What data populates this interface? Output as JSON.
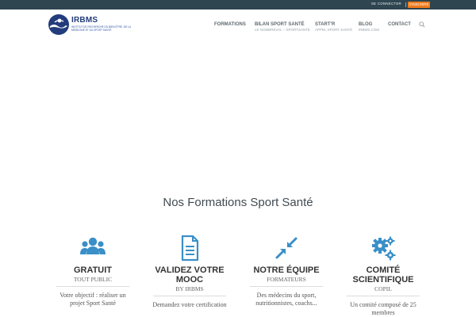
{
  "topbar": {
    "login_label": "SE CONNECTER",
    "signup_label": "S'INSCRIRE",
    "signup_color": "#f07a1a"
  },
  "logo": {
    "brand": "IRBMS",
    "tagline": "Institut de Recherche du Bien-être, de la Médecine et du Sport Santé"
  },
  "nav": {
    "items": [
      {
        "label": "FORMATIONS",
        "sub": ""
      },
      {
        "label": "BILAN SPORT SANTÉ",
        "sub": "LE NOMBREVAL – SPORTSANTÉ"
      },
      {
        "label": "START'R",
        "sub": "APPEL SPORT SANTÉ"
      },
      {
        "label": "BLOG",
        "sub": "IRBMS.COM"
      },
      {
        "label": "CONTACT",
        "sub": ""
      }
    ],
    "search_icon": "search-icon"
  },
  "main": {
    "section_title": "Nos Formations Sport Santé",
    "accent_color": "#3a8fc7",
    "cards": [
      {
        "icon": "users-icon",
        "title": "GRATUIT",
        "subtitle": "TOUT PUBLIC",
        "desc": "Votre objectif : réaliser un projet Sport Santé"
      },
      {
        "icon": "document-icon",
        "title": "VALIDEZ VOTRE MOOC",
        "subtitle": "BY IRBMS",
        "desc": "Demandez votre certification"
      },
      {
        "icon": "compress-arrows-icon",
        "title": "NOTRE ÉQUIPE",
        "subtitle": "FORMATEURS",
        "desc": "Des médecins du sport, nutritionnistes, coachs..."
      },
      {
        "icon": "gears-icon",
        "title": "COMITÉ SCIENTIFIQUE",
        "subtitle": "COPIL",
        "desc": "Un comité composé de 25 membres"
      }
    ]
  }
}
